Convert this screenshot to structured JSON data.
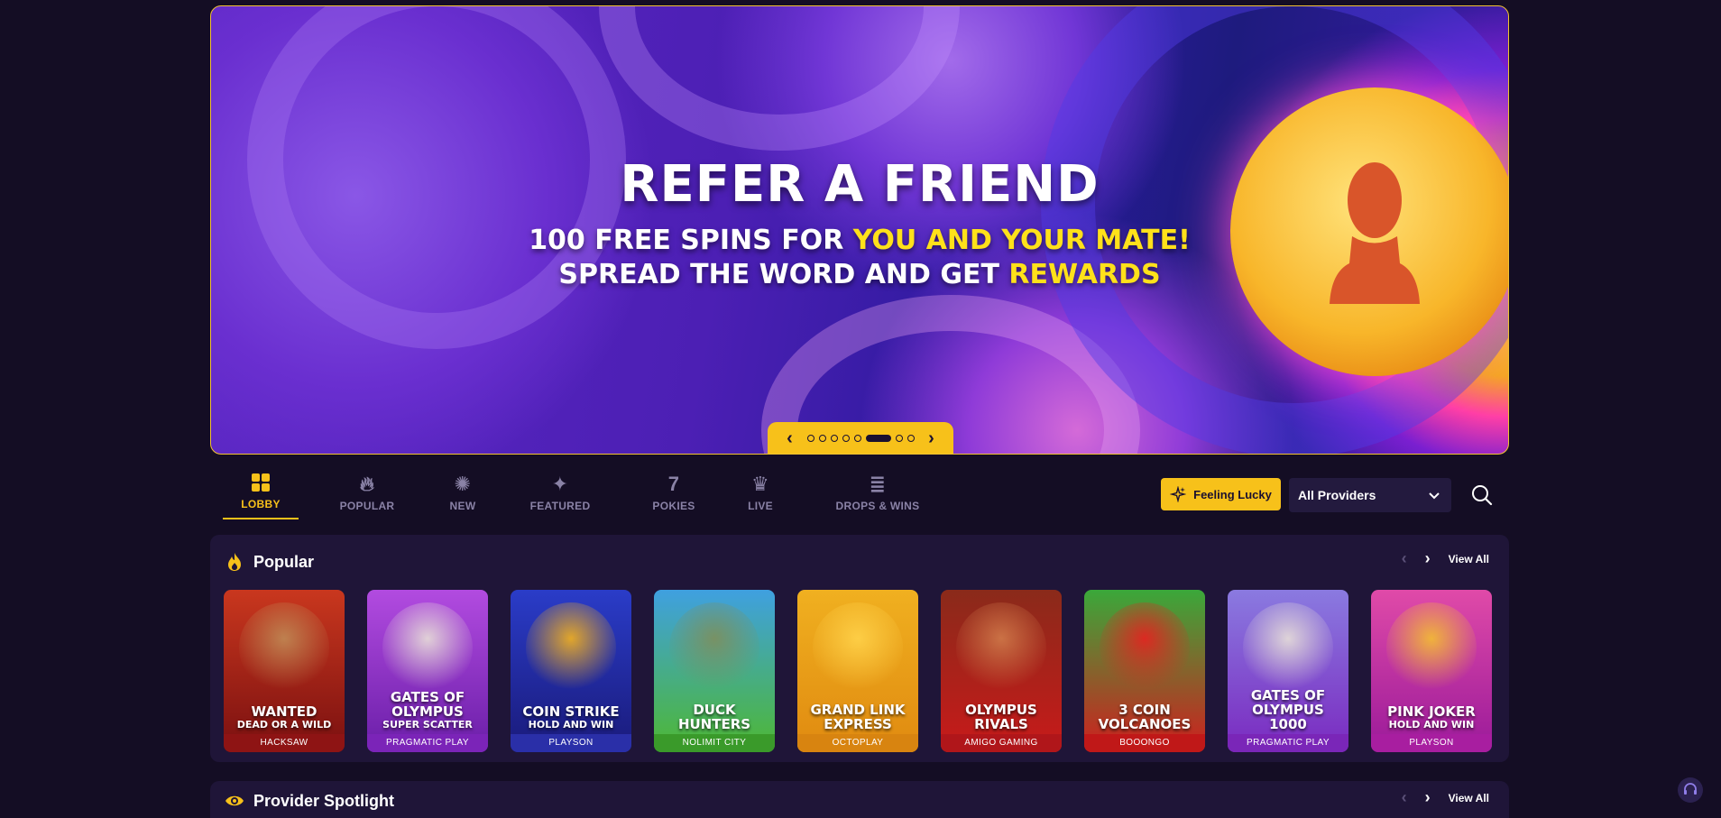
{
  "banner": {
    "title": "REFER A FRIEND",
    "line1_prefix": "100 FREE SPINS FOR ",
    "line1_highlight": "YOU AND YOUR MATE!",
    "line2_prefix": "SPREAD THE WORD AND GET ",
    "line2_highlight": "REWARDS",
    "prev_icon": "chevron-left-icon",
    "next_icon": "chevron-right-icon",
    "slide_count": 8,
    "active_slide": 5
  },
  "nav": {
    "tabs": [
      {
        "id": "lobby",
        "label": "LOBBY",
        "icon": "grid-icon",
        "active": true
      },
      {
        "id": "popular",
        "label": "POPULAR",
        "icon": "flame-icon",
        "active": false
      },
      {
        "id": "new",
        "label": "NEW",
        "icon": "new-badge-icon",
        "active": false
      },
      {
        "id": "featured",
        "label": "FEATURED",
        "icon": "sparkle-icon",
        "active": false
      },
      {
        "id": "pokies",
        "label": "POKIES",
        "icon": "seven-icon",
        "active": false
      },
      {
        "id": "live",
        "label": "LIVE",
        "icon": "dealer-icon",
        "active": false
      },
      {
        "id": "drops",
        "label": "DROPS & WINS",
        "icon": "coin-stack-icon",
        "active": false
      }
    ],
    "lucky_label": "Feeling Lucky",
    "providers_value": "All Providers",
    "search_icon": "search-icon"
  },
  "popular": {
    "title": "Popular",
    "view_all": "View All",
    "games": [
      {
        "name": "WANTED",
        "sub": "DEAD OR A WILD",
        "provider": "HACKSAW",
        "bg1": "#c9371e",
        "bg2": "#7a1010",
        "art": "#c08a55",
        "band": "#8e1414"
      },
      {
        "name": "GATES OF OLYMPUS",
        "sub": "SUPER SCATTER",
        "provider": "PRAGMATIC PLAY",
        "bg1": "#b24be0",
        "bg2": "#6a1ea8",
        "art": "#e8e0d8",
        "band": "#7b24b8"
      },
      {
        "name": "COIN STRIKE",
        "sub": "HOLD AND WIN",
        "provider": "PLAYSON",
        "bg1": "#2a3cc8",
        "bg2": "#1a1a7a",
        "art": "#f6b31c",
        "band": "#2a2fa8"
      },
      {
        "name": "DUCK HUNTERS",
        "sub": "",
        "provider": "NOLIMIT CITY",
        "bg1": "#3fa0e0",
        "bg2": "#4eb832",
        "art": "#7e8f5c",
        "band": "#3a9a2a"
      },
      {
        "name": "GRAND LINK EXPRESS",
        "sub": "",
        "provider": "OCTOPLAY",
        "bg1": "#f0b020",
        "bg2": "#e08a10",
        "art": "#ffd24a",
        "band": "#d88410"
      },
      {
        "name": "OLYMPUS RIVALS",
        "sub": "",
        "provider": "AMIGO GAMING",
        "bg1": "#8a2a1a",
        "bg2": "#c81a1a",
        "art": "#d07a4a",
        "band": "#b0161a"
      },
      {
        "name": "3 COIN VOLCANOES",
        "sub": "",
        "provider": "BOOONGO",
        "bg1": "#3aa83a",
        "bg2": "#d01e1e",
        "art": "#e82020",
        "band": "#c01818"
      },
      {
        "name": "GATES OF OLYMPUS 1000",
        "sub": "",
        "provider": "PRAGMATIC PLAY",
        "bg1": "#8a7ae0",
        "bg2": "#7a2ac0",
        "art": "#e8e0d8",
        "band": "#7a26b8"
      },
      {
        "name": "PINK JOKER",
        "sub": "HOLD AND WIN",
        "provider": "PLAYSON",
        "bg1": "#e04aa8",
        "bg2": "#9a1a9a",
        "art": "#f4c030",
        "band": "#a81ea0"
      }
    ]
  },
  "provider": {
    "title": "Provider Spotlight",
    "view_all": "View All"
  },
  "colors": {
    "accent": "#f7c11a",
    "page_bg": "#140d24",
    "section_bg": "#1f1538"
  }
}
